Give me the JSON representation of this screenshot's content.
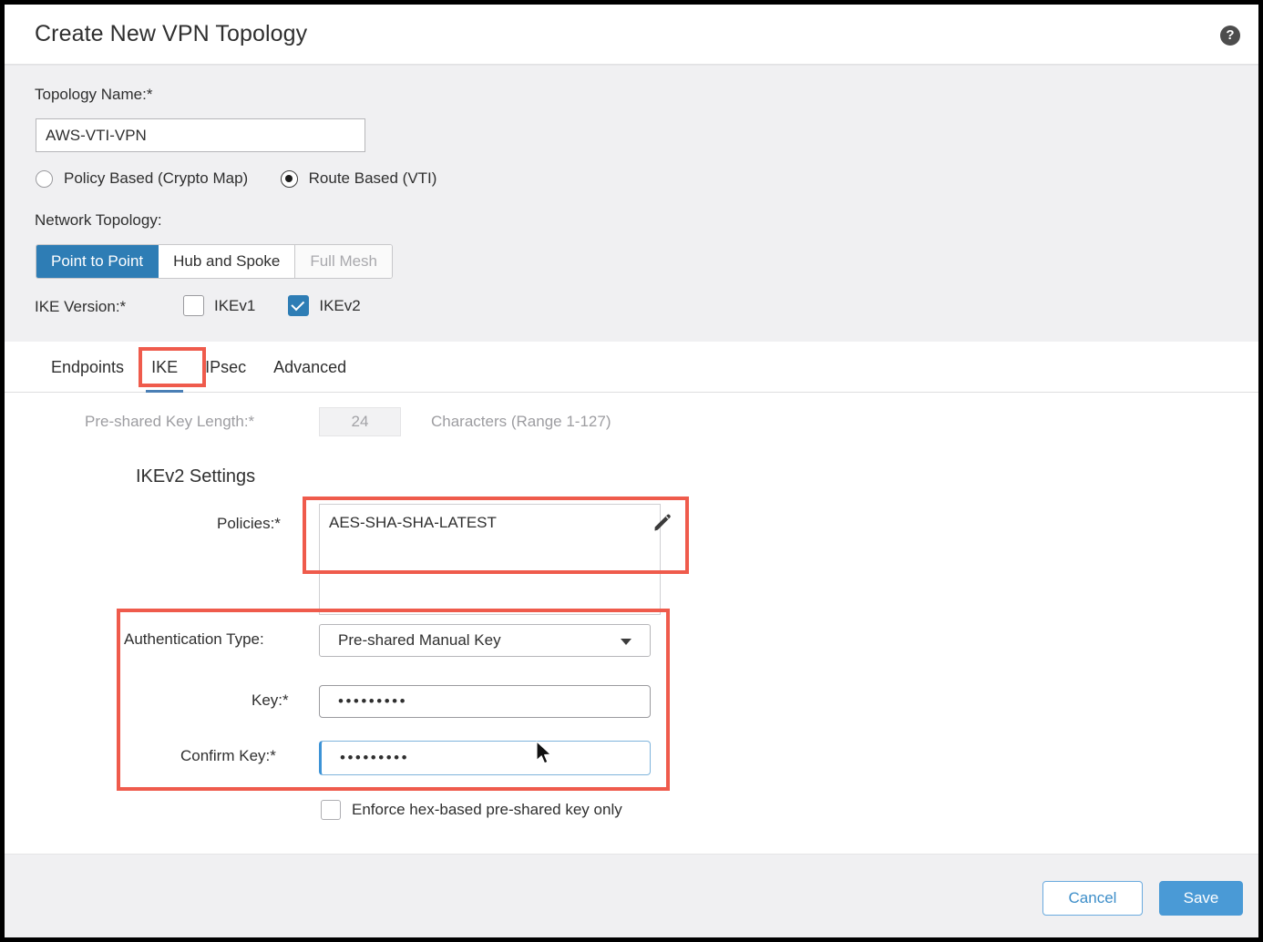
{
  "dialog": {
    "title": "Create New VPN Topology",
    "help_icon": "help-circle-icon"
  },
  "form": {
    "topology_name_label": "Topology Name:*",
    "topology_name_value": "AWS-VTI-VPN",
    "topology_name_placeholder": "Topology Name",
    "vpn_type_options": [
      {
        "label": "Policy Based (Crypto Map)",
        "selected": false
      },
      {
        "label": "Route Based (VTI)",
        "selected": true
      }
    ],
    "network_topology_label": "Network Topology:",
    "network_topology_options": [
      {
        "label": "Point to Point",
        "state": "active"
      },
      {
        "label": "Hub and Spoke",
        "state": "normal"
      },
      {
        "label": "Full Mesh",
        "state": "disabled"
      }
    ],
    "ike_version_label": "IKE Version:*",
    "ike_versions": [
      {
        "label": "IKEv1",
        "checked": false
      },
      {
        "label": "IKEv2",
        "checked": true
      }
    ]
  },
  "tabs": [
    {
      "label": "Endpoints",
      "active": false
    },
    {
      "label": "IKE",
      "active": true
    },
    {
      "label": "IPsec",
      "active": false
    },
    {
      "label": "Advanced",
      "active": false
    }
  ],
  "ike_panel": {
    "psk_length_label": "Pre-shared Key Length:*",
    "psk_length_value": "24",
    "psk_length_suffix": "Characters  (Range 1-127)",
    "section_heading": "IKEv2 Settings",
    "policies_label": "Policies:*",
    "policies_value": "AES-SHA-SHA-LATEST",
    "policies_edit_icon": "pencil-edit-icon",
    "auth_type_label": "Authentication Type:",
    "auth_type_value": "Pre-shared Manual Key",
    "auth_type_caret_icon": "chevron-down-icon",
    "key_label": "Key:*",
    "key_value": "•••••••••",
    "confirm_key_label": "Confirm Key:*",
    "confirm_key_value": "•••••••••",
    "enforce_hex_label": "Enforce hex-based pre-shared key only",
    "enforce_hex_checked": false
  },
  "footer": {
    "cancel_label": "Cancel",
    "save_label": "Save"
  },
  "colors": {
    "accent_blue": "#2e7db5",
    "save_blue": "#4a9ad6",
    "highlight_red": "#ef5b4c",
    "panel_grey": "#f0f0f2",
    "focus_blue": "#3d93d6"
  }
}
